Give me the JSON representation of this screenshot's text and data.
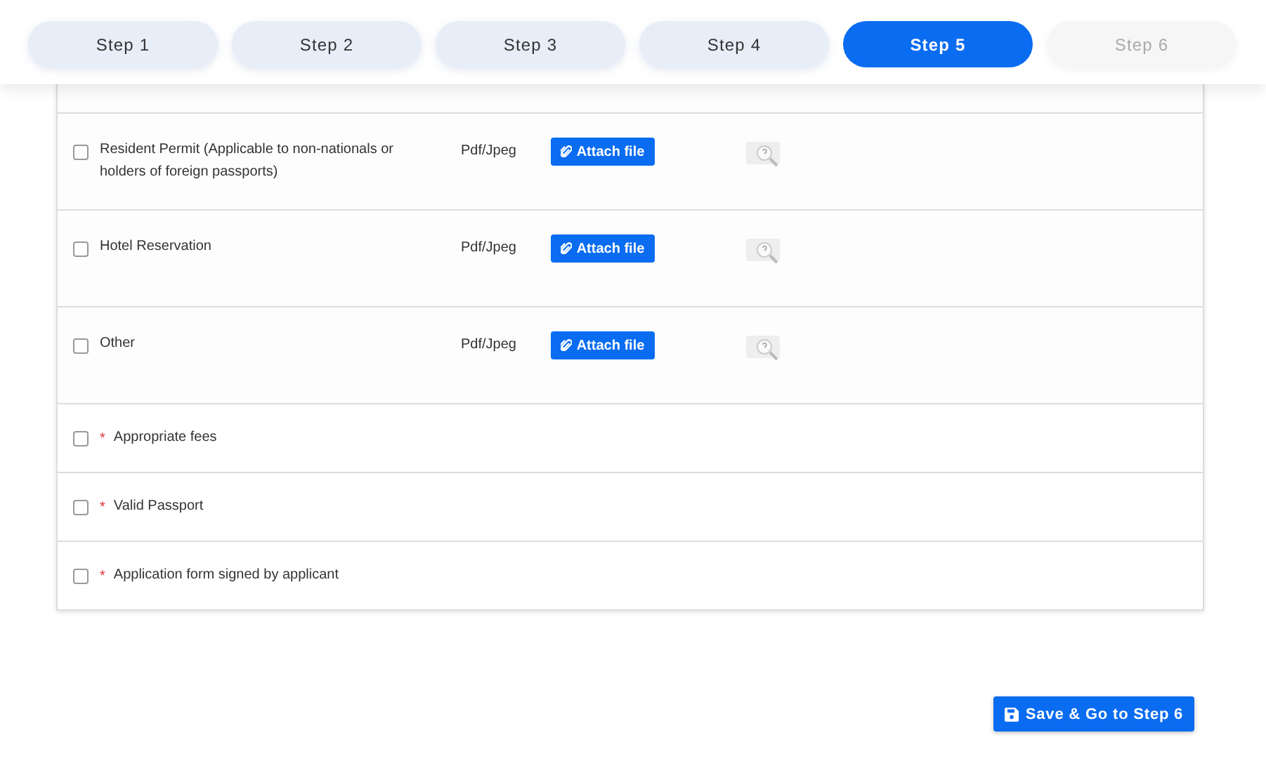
{
  "steps": [
    {
      "label": "Step 1",
      "selected": false,
      "disabled": false
    },
    {
      "label": "Step 2",
      "selected": false,
      "disabled": false
    },
    {
      "label": "Step 3",
      "selected": false,
      "disabled": false
    },
    {
      "label": "Step 4",
      "selected": false,
      "disabled": false
    },
    {
      "label": "Step 5",
      "selected": true,
      "disabled": false
    },
    {
      "label": "Step 6",
      "selected": false,
      "disabled": true
    }
  ],
  "documents": [
    {
      "kind": "upload",
      "checked": false,
      "label": "Resident Permit (Applicable to non-nationals or holders of foreign passports)",
      "format": "Pdf/Jpeg",
      "button": "Attach file"
    },
    {
      "kind": "upload",
      "checked": false,
      "label": "Hotel Reservation",
      "format": "Pdf/Jpeg",
      "button": "Attach file"
    },
    {
      "kind": "upload",
      "checked": false,
      "label": "Other",
      "format": "Pdf/Jpeg",
      "button": "Attach file"
    },
    {
      "kind": "check",
      "checked": false,
      "marker": "*",
      "label": "Appropriate fees"
    },
    {
      "kind": "check",
      "checked": false,
      "marker": "*",
      "label": "Valid Passport"
    },
    {
      "kind": "check",
      "checked": false,
      "marker": "*",
      "label": "Application form signed by applicant"
    }
  ],
  "save_button": "Save & Go to Step 6"
}
